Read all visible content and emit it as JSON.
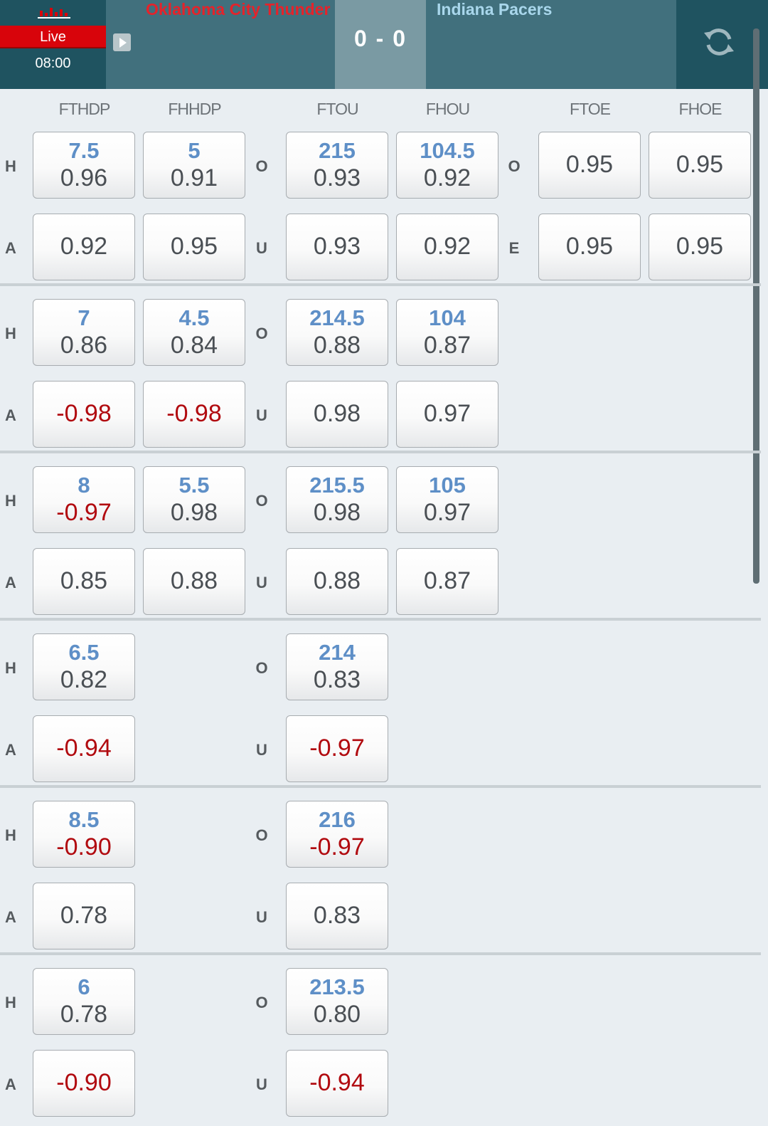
{
  "header": {
    "live_label": "Live",
    "clock": "08:00",
    "home_team": "Oklahoma City Thunder",
    "away_team": "Indiana Pacers",
    "score": "0 - 0",
    "colors": {
      "live": "#d8040b",
      "home_team": "#e4232b",
      "away_team": "#a9d7ec"
    },
    "icons": [
      "bar-chart-icon",
      "play-icon",
      "refresh-icon"
    ]
  },
  "columns": [
    "FTHDP",
    "FHHDP",
    "FTOU",
    "FHOU",
    "FTOE",
    "FHOE"
  ],
  "blocks": [
    {
      "rows": [
        {
          "side": "H",
          "ftHdp": {
            "line": "7.5",
            "odds": "0.96"
          },
          "fhHdp": {
            "line": "5",
            "odds": "0.91"
          },
          "ouSide": "O",
          "ftOu": {
            "line": "215",
            "odds": "0.93"
          },
          "fhOu": {
            "line": "104.5",
            "odds": "0.92"
          },
          "oeSide": "O",
          "ftOe": {
            "odds": "0.95"
          },
          "fhOe": {
            "odds": "0.95"
          }
        },
        {
          "side": "A",
          "ftHdp": {
            "odds": "0.92"
          },
          "fhHdp": {
            "odds": "0.95"
          },
          "ouSide": "U",
          "ftOu": {
            "odds": "0.93"
          },
          "fhOu": {
            "odds": "0.92"
          },
          "oeSide": "E",
          "ftOe": {
            "odds": "0.95"
          },
          "fhOe": {
            "odds": "0.95"
          }
        }
      ]
    },
    {
      "rows": [
        {
          "side": "H",
          "ftHdp": {
            "line": "7",
            "odds": "0.86"
          },
          "fhHdp": {
            "line": "4.5",
            "odds": "0.84"
          },
          "ouSide": "O",
          "ftOu": {
            "line": "214.5",
            "odds": "0.88"
          },
          "fhOu": {
            "line": "104",
            "odds": "0.87"
          }
        },
        {
          "side": "A",
          "ftHdp": {
            "odds": "-0.98"
          },
          "fhHdp": {
            "odds": "-0.98"
          },
          "ouSide": "U",
          "ftOu": {
            "odds": "0.98"
          },
          "fhOu": {
            "odds": "0.97"
          }
        }
      ]
    },
    {
      "rows": [
        {
          "side": "H",
          "ftHdp": {
            "line": "8",
            "odds": "-0.97"
          },
          "fhHdp": {
            "line": "5.5",
            "odds": "0.98"
          },
          "ouSide": "O",
          "ftOu": {
            "line": "215.5",
            "odds": "0.98"
          },
          "fhOu": {
            "line": "105",
            "odds": "0.97"
          }
        },
        {
          "side": "A",
          "ftHdp": {
            "odds": "0.85"
          },
          "fhHdp": {
            "odds": "0.88"
          },
          "ouSide": "U",
          "ftOu": {
            "odds": "0.88"
          },
          "fhOu": {
            "odds": "0.87"
          }
        }
      ]
    },
    {
      "rows": [
        {
          "side": "H",
          "ftHdp": {
            "line": "6.5",
            "odds": "0.82"
          },
          "ouSide": "O",
          "ftOu": {
            "line": "214",
            "odds": "0.83"
          }
        },
        {
          "side": "A",
          "ftHdp": {
            "odds": "-0.94"
          },
          "ouSide": "U",
          "ftOu": {
            "odds": "-0.97"
          }
        }
      ]
    },
    {
      "rows": [
        {
          "side": "H",
          "ftHdp": {
            "line": "8.5",
            "odds": "-0.90"
          },
          "ouSide": "O",
          "ftOu": {
            "line": "216",
            "odds": "-0.97"
          }
        },
        {
          "side": "A",
          "ftHdp": {
            "odds": "0.78"
          },
          "ouSide": "U",
          "ftOu": {
            "odds": "0.83"
          }
        }
      ]
    },
    {
      "rows": [
        {
          "side": "H",
          "ftHdp": {
            "line": "6",
            "odds": "0.78"
          },
          "ouSide": "O",
          "ftOu": {
            "line": "213.5",
            "odds": "0.80"
          }
        },
        {
          "side": "A",
          "ftHdp": {
            "odds": "-0.90"
          },
          "ouSide": "U",
          "ftOu": {
            "odds": "-0.94"
          }
        }
      ]
    }
  ]
}
